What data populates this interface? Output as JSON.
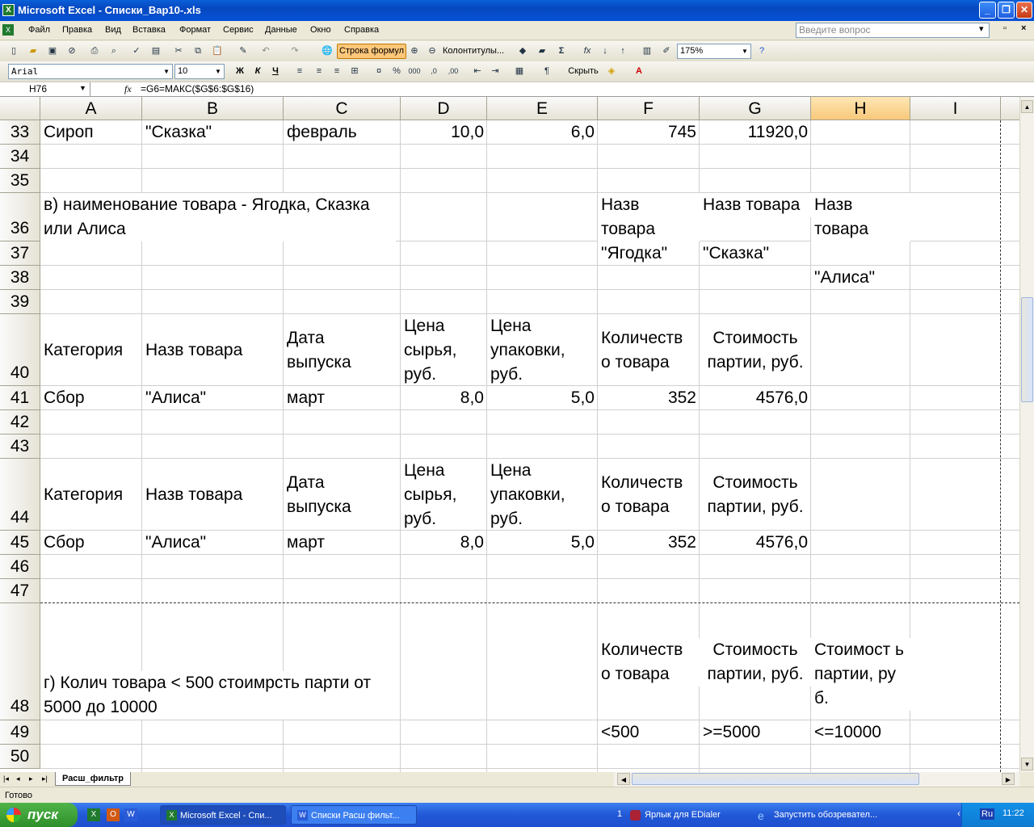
{
  "window": {
    "title": "Microsoft Excel - Списки_Вар10-.xls"
  },
  "menu": {
    "items": [
      "Файл",
      "Правка",
      "Вид",
      "Вставка",
      "Формат",
      "Сервис",
      "Данные",
      "Окно",
      "Справка"
    ],
    "ask_placeholder": "Введите вопрос"
  },
  "toolbar1": {
    "formula_bar_btn": "Строка формул",
    "headers_btn": "Колонтитулы...",
    "zoom": "175%"
  },
  "toolbar2": {
    "font": "Arial",
    "size": "10",
    "bold": "Ж",
    "italic": "К",
    "underline": "Ч",
    "hide": "Скрыть"
  },
  "formula_bar": {
    "name_box": "H76",
    "fx": "fx",
    "formula": "=G6=МАКС($G$6:$G$16)"
  },
  "columns": [
    "A",
    "B",
    "C",
    "D",
    "E",
    "F",
    "G",
    "H",
    "I"
  ],
  "selected_column": "H",
  "rows": [
    "33",
    "34",
    "35",
    "36",
    "37",
    "38",
    "39",
    "40",
    "41",
    "42",
    "43",
    "44",
    "45",
    "46",
    "47",
    "48",
    "49",
    "50"
  ],
  "cells": {
    "r33": {
      "a": "Сироп",
      "b": "\"Сказка\"",
      "c": "февраль",
      "d": "10,0",
      "e": "6,0",
      "f": "745",
      "g": "11920,0"
    },
    "r36": {
      "a": "в) наименование товара - Ягодка, Сказка или Алиса",
      "f": "Назв товара",
      "g": "Назв товара",
      "h": "Назв товара"
    },
    "r37": {
      "f": "\"Ягодка\"",
      "g": "\"Сказка\""
    },
    "r38": {
      "h": "\"Алиса\""
    },
    "r40": {
      "a": "Категория",
      "b": "Назв товара",
      "c": "Дата выпуска",
      "d": "Цена сырья, руб.",
      "e": "Цена упаковки, руб.",
      "f": "Количеств о товара",
      "g": "Стоимость партии, руб."
    },
    "r41": {
      "a": "Сбор",
      "b": "\"Алиса\"",
      "c": "март",
      "d": "8,0",
      "e": "5,0",
      "f": "352",
      "g": "4576,0"
    },
    "r44": {
      "a": "Категория",
      "b": "Назв товара",
      "c": "Дата выпуска",
      "d": "Цена сырья, руб.",
      "e": "Цена упаковки, руб.",
      "f": "Количеств о товара",
      "g": "Стоимость партии, руб."
    },
    "r45": {
      "a": "Сбор",
      "b": "\"Алиса\"",
      "c": "март",
      "d": "8,0",
      "e": "5,0",
      "f": "352",
      "g": "4576,0"
    },
    "r48": {
      "a": "г) Колич товара < 500 стоимрсть парти от 5000 до 10000",
      "f": "Количеств о товара",
      "g": "Стоимость партии, руб.",
      "h": "Стоимост ь партии, руб."
    },
    "r49": {
      "f": "<500",
      "g": ">=5000",
      "h": "<=10000"
    }
  },
  "sheet_tab": "Расш_фильтр",
  "status": "Готово",
  "taskbar": {
    "start": "пуск",
    "tasks": [
      "Microsoft Excel - Спи...",
      "Списки Расш фильт...",
      "Ярлык для EDialer",
      "Запустить обозревател..."
    ],
    "lang": "Ru",
    "clock": "11:22",
    "group_count": "1"
  }
}
